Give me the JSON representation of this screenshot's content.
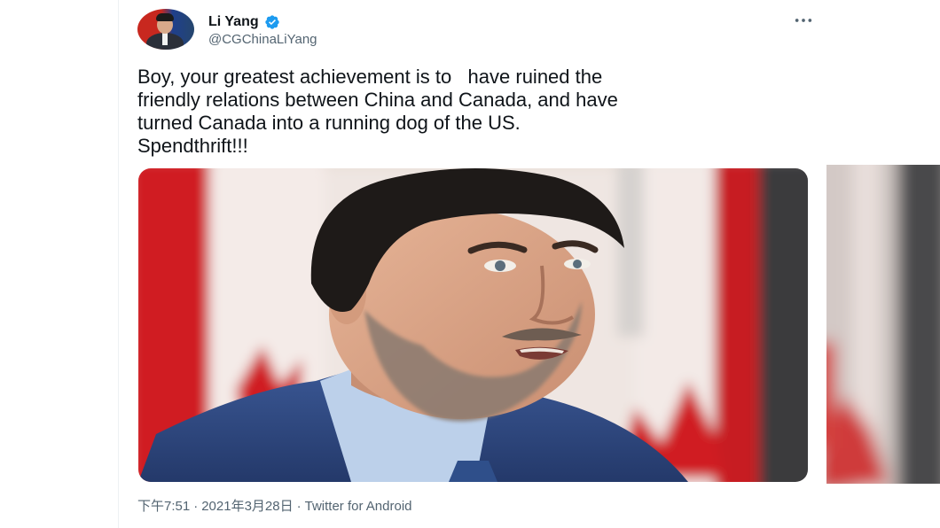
{
  "author": {
    "display_name": "Li Yang",
    "handle": "@CGChinaLiYang",
    "verified": true,
    "avatar_icon": "profile-photo"
  },
  "tweet": {
    "text": "Boy, your greatest achievement is to   have ruined the\nfriendly relations between China and Canada, and have\nturned Canada into a running dog of the US.\nSpendthrift!!!",
    "timestamp": "下午7:51",
    "date": "2021年3月28日",
    "separator": "·",
    "client": "Twitter for Android"
  },
  "media": {
    "description_icon": "photo-man-speaking-in-front-of-canadian-flags"
  },
  "colors": {
    "verified_blue": "#1d9bf0",
    "text_primary": "#0f1419",
    "text_secondary": "#536471",
    "flag_red": "#d21f24"
  },
  "icons": {
    "verified": "verified-badge-icon",
    "more": "more-options-icon"
  }
}
